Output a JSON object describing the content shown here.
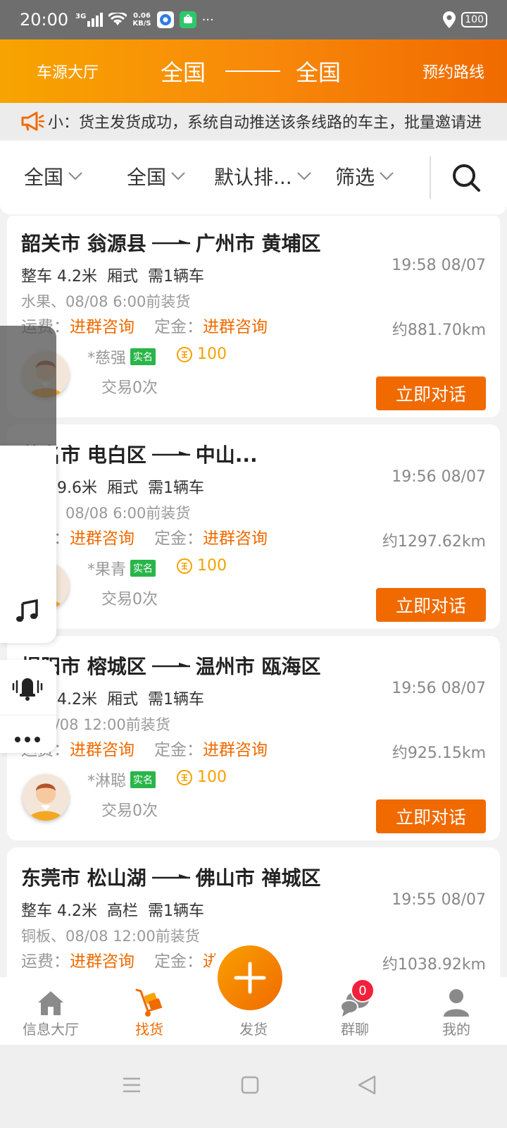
{
  "status_bar": {
    "time": "20:00",
    "network": "3G",
    "speed_value": "0.06",
    "speed_unit": "KB/S",
    "more": "···",
    "battery": "100"
  },
  "header": {
    "left": "车源大厅",
    "from": "全国",
    "to": "全国",
    "right": "预约路线"
  },
  "notice": {
    "text": "小：货主发货成功，系统自动推送该条线路的车主，批量邀请进"
  },
  "filters": [
    "全国",
    "全国",
    "默认排...",
    "筛选"
  ],
  "cards": [
    {
      "from": "韶关市 翁源县",
      "to": "广州市 黄埔区",
      "spec": "整车 4.2米  厢式  需1辆车",
      "time": "19:58 08/07",
      "goods": "水果、08/08 6:00前装货",
      "fee_label": "运费：",
      "fee_value": "进群咨询",
      "deposit_label": "定金：",
      "deposit_value": "进群咨询",
      "distance": "约881.70km",
      "owner": "*慈强",
      "verify": "实名",
      "credit": "100",
      "trades": "交易0次",
      "button": "立即对话"
    },
    {
      "from": "茂名市 电白区",
      "to": "中山...",
      "spec": "整车 9.6米  厢式  需1辆车",
      "time": "19:56 08/07",
      "goods": "食品、08/08 6:00前装货",
      "fee_label": "运费：",
      "fee_value": "进群咨询",
      "deposit_label": "定金：",
      "deposit_value": "进群咨询",
      "distance": "约1297.62km",
      "owner": "*果青",
      "verify": "实名",
      "credit": "100",
      "trades": "交易0次",
      "button": "立即对话"
    },
    {
      "from": "揭阳市 榕城区",
      "to": "温州市 瓯海区",
      "spec": "整车 4.2米  厢式  需1辆车",
      "time": "19:56 08/07",
      "goods": "、08/08 12:00前装货",
      "fee_label": "运费：",
      "fee_value": "进群咨询",
      "deposit_label": "定金：",
      "deposit_value": "进群咨询",
      "distance": "约925.15km",
      "owner": "*淋聪",
      "verify": "实名",
      "credit": "100",
      "trades": "交易0次",
      "button": "立即对话"
    },
    {
      "from": "东莞市 松山湖",
      "to": "佛山市 禅城区",
      "spec": "整车 4.2米  高栏  需1辆车",
      "time": "19:55 08/07",
      "goods": "铜板、08/08 12:00前装货",
      "fee_label": "运费：",
      "fee_value": "进群咨询",
      "deposit_label": "定金：",
      "deposit_value": "进群咨询",
      "distance": "约1038.92km",
      "owner": "",
      "verify": "",
      "credit": "",
      "trades": "",
      "button": ""
    }
  ],
  "bottom_nav": [
    {
      "label": "信息大厅",
      "icon": "home-icon"
    },
    {
      "label": "找货",
      "icon": "cart-icon",
      "active": true
    },
    {
      "label": "发货",
      "icon": "plus-icon"
    },
    {
      "label": "群聊",
      "icon": "chat-icon"
    },
    {
      "label": "我的",
      "icon": "user-icon"
    }
  ],
  "chat_badge": "0",
  "colors": {
    "accent": "#f06a00",
    "header_start": "#f7a400",
    "verify_green": "#2ab54a",
    "badge_red": "#f2213b"
  }
}
